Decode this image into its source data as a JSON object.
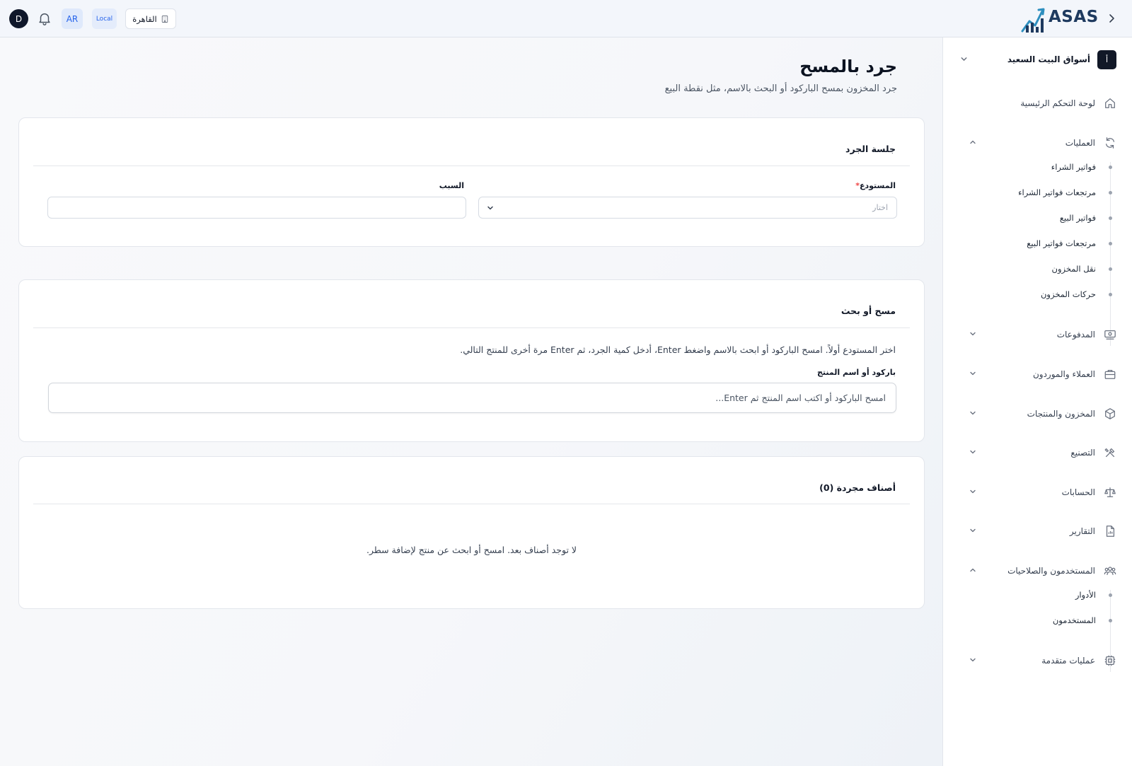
{
  "topbar": {
    "user_initial": "D",
    "lang": "AR",
    "env": "Local",
    "branch": "القاهرة",
    "brand": "ASAS"
  },
  "sidebar": {
    "company": {
      "initial": "أ",
      "name": "أسواق البيت السعيد"
    },
    "items": [
      {
        "label": "لوحة التحكم الرئيسية",
        "icon": "home-icon"
      },
      {
        "label": "العمليات",
        "icon": "refresh-icon",
        "expanded": true,
        "children": [
          "فواتير الشراء",
          "مرتجعات فواتير الشراء",
          "فواتير البيع",
          "مرتجعات فواتير البيع",
          "نقل المخزون",
          "حركات المخزون"
        ]
      },
      {
        "label": "المدفوعات",
        "icon": "payments-icon"
      },
      {
        "label": "العملاء والموردون",
        "icon": "briefcase-icon"
      },
      {
        "label": "المخزون والمنتجات",
        "icon": "box-icon"
      },
      {
        "label": "التصنيع",
        "icon": "tools-icon"
      },
      {
        "label": "الحسابات",
        "icon": "scale-icon"
      },
      {
        "label": "التقارير",
        "icon": "report-icon"
      },
      {
        "label": "المستخدمون والصلاحيات",
        "icon": "users-icon",
        "expanded": true,
        "children": [
          "الأدوار",
          "المستخدمون"
        ]
      },
      {
        "label": "عمليات متقدمة",
        "icon": "cpu-icon"
      }
    ]
  },
  "page": {
    "title": "جرد بالمسح",
    "subtitle": "جرد المخزون بمسح الباركود أو البحث بالاسم، مثل نقطة البيع"
  },
  "session_card": {
    "title": "جلسة الجرد",
    "warehouse_label": "المستودع",
    "warehouse_required": "*",
    "warehouse_placeholder": "اختار",
    "reason_label": "السبب",
    "reason_value": ""
  },
  "scan_card": {
    "title": "مسح أو بحث",
    "help": "اختر المستودع أولاً. امسح الباركود أو ابحث بالاسم واضغط Enter، أدخل كمية الجرد، ثم Enter مرة أخرى للمنتج التالي.",
    "input_label": "باركود أو اسم المنتج",
    "input_placeholder": "امسح الباركود أو اكتب اسم المنتج ثم Enter..."
  },
  "items_card": {
    "title": "أصناف مجردة (0)",
    "empty": "لا توجد أصناف بعد. امسح أو ابحث عن منتج لإضافة سطر."
  },
  "colors": {
    "accent": "#2563eb",
    "required": "#ef4444",
    "brand": "#1e3a5f"
  }
}
